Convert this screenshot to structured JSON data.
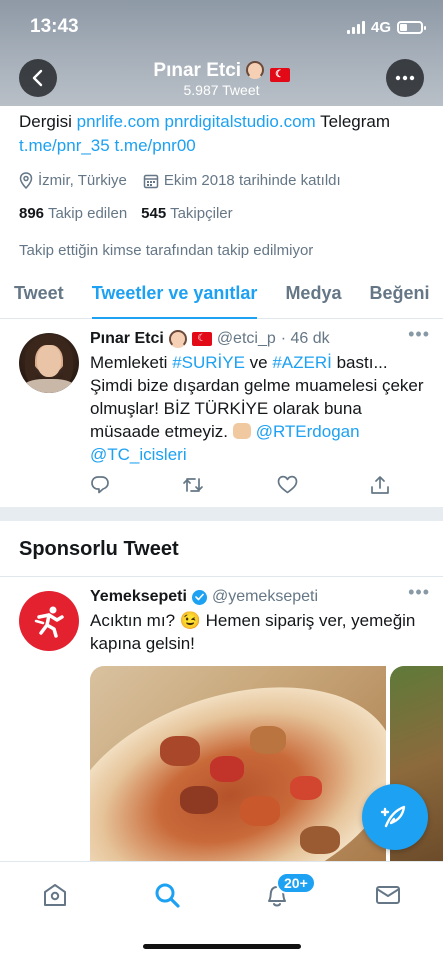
{
  "status_bar": {
    "time": "13:43",
    "network": "4G"
  },
  "header": {
    "name": "Pınar Etci",
    "tweet_count": "5.987 Tweet"
  },
  "profile": {
    "bio_line1_prefix": "Dergisi ",
    "bio_link1": "pnrlife.com",
    "bio_link2": "pnrdigitalstudio.com",
    "bio_line1_suffix": " Telegram",
    "bio_link3": "t.me/pnr_35",
    "bio_link4": "t.me/pnr00",
    "location": "İzmir, Türkiye",
    "joined": "Ekim 2018 tarihinde katıldı",
    "following_count": "896",
    "following_label": "Takip edilen",
    "followers_count": "545",
    "followers_label": "Takipçiler",
    "follow_note": "Takip ettiğin kimse tarafından takip edilmiyor"
  },
  "tabs": [
    {
      "label": "Tweet"
    },
    {
      "label": "Tweetler ve yanıtlar"
    },
    {
      "label": "Medya"
    },
    {
      "label": "Beğeni"
    }
  ],
  "tweet": {
    "name": "Pınar Etci",
    "handle": "@etci_p",
    "time": "· 46 dk",
    "text_1": "Memleketi ",
    "hashtag_1": "#SURİYE",
    "text_2": " ve ",
    "hashtag_2": "#AZERİ",
    "text_3": " bastı... Şimdi bize dışardan gelme muamelesi çeker olmuşlar! BİZ TÜRKİYE olarak buna müsaade etmeyiz. ",
    "mention_1": "@RTErdogan",
    "mention_2": "@TC_icisleri"
  },
  "sponsored": {
    "section_title": "Sponsorlu Tweet",
    "name": "Yemeksepeti",
    "handle": "@yemeksepeti",
    "text": "Acıktın mı? 😉 Hemen sipariş ver, yemeğin kapına gelsin!"
  },
  "nav": {
    "notifications_badge": "20+"
  },
  "colors": {
    "accent": "#1da1f2",
    "text": "#14171a",
    "secondary": "#657786",
    "brand_red": "#e3212f"
  }
}
